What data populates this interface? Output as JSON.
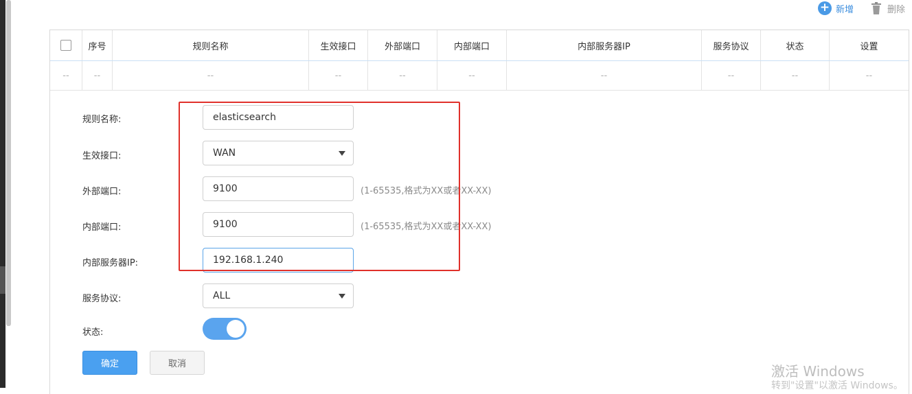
{
  "toolbar": {
    "add_label": "新增",
    "delete_label": "删除"
  },
  "table": {
    "headers": [
      "序号",
      "规则名称",
      "生效接口",
      "外部端口",
      "内部端口",
      "内部服务器IP",
      "服务协议",
      "状态",
      "设置"
    ],
    "row": [
      "--",
      "--",
      "--",
      "--",
      "--",
      "--",
      "--",
      "--",
      "--",
      "--"
    ]
  },
  "form": {
    "rule_name_label": "规则名称:",
    "rule_name_value": "elasticsearch",
    "interface_label": "生效接口:",
    "interface_value": "WAN",
    "external_port_label": "外部端口:",
    "external_port_value": "9100",
    "external_port_hint": "(1-65535,格式为XX或者XX-XX)",
    "internal_port_label": "内部端口:",
    "internal_port_value": "9100",
    "internal_port_hint": "(1-65535,格式为XX或者XX-XX)",
    "server_ip_label": "内部服务器IP:",
    "server_ip_value": "192.168.1.240",
    "protocol_label": "服务协议:",
    "protocol_value": "ALL",
    "status_label": "状态:",
    "status_enabled": true,
    "confirm_label": "确定",
    "cancel_label": "取消"
  },
  "watermark": {
    "line1": "激活 Windows",
    "line2": "转到\"设置\"以激活 Windows。"
  },
  "colors": {
    "accent": "#4aa0f0",
    "highlight_box": "#e0302a",
    "toggle_on": "#5aa4ee"
  }
}
